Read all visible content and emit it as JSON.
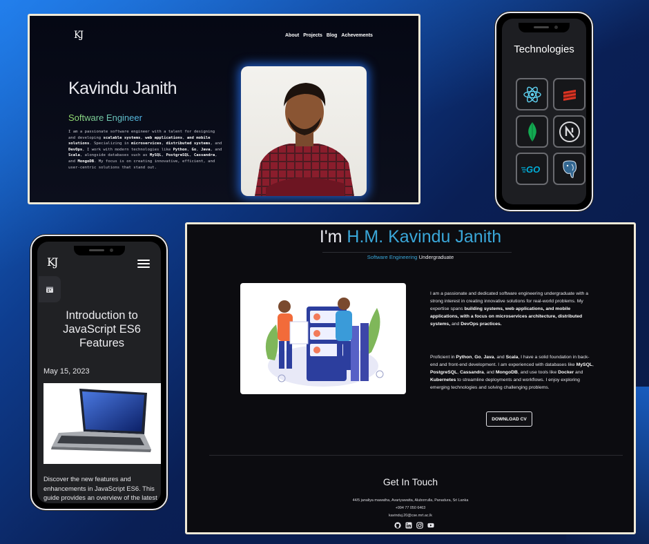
{
  "hero": {
    "logo": "KJ",
    "nav": [
      "About",
      "Projects",
      "Blog",
      "Achevements"
    ],
    "name": "Kavindu Janith",
    "role": "Software Engineer",
    "bio_parts": [
      "I am a passionate software engineer with a talent for designing and developing ",
      "scalable systems",
      ", ",
      "web applications",
      ", ",
      "and mobile solutions",
      ". Specializing in ",
      "microservices",
      ", ",
      "distributed systems",
      ", and ",
      "DevOps",
      ", I work with modern technologies like ",
      "Python",
      ", ",
      "Go",
      ", ",
      "Java",
      ", and ",
      "Scala",
      ", alongside databases such as ",
      "MySQL",
      ", ",
      "PostgreSQL",
      ", ",
      "Cassandra",
      ", and ",
      "MongoDB",
      ". My focus is on creating innovative, efficient, and user-centric solutions that stand out."
    ]
  },
  "tech": {
    "title": "Technologies",
    "icons": [
      "react-icon",
      "scala-icon",
      "mongodb-icon",
      "nextjs-icon",
      "go-icon",
      "postgresql-icon"
    ],
    "go_label": "GO"
  },
  "blog": {
    "logo": "KJ",
    "title": "Introduction to JavaScript ES6 Features",
    "date": "May 15, 2023",
    "description": "Discover the new features and enhancements in JavaScript ES6. This guide provides an overview of the latest"
  },
  "about": {
    "heading_prefix": "I'm ",
    "heading_name": "H.M. Kavindu Janith",
    "sub_highlight": "Software Engineering",
    "sub_rest": " Undergraduate",
    "p1_parts": [
      "I am a passionate and dedicated software engineering undergraduate with a strong interest in creating innovative solutions for real-world problems. My expertise spans ",
      "building systems, web applications, and mobile applications, with a focus on microservices architecture, distributed systems,",
      " and ",
      "DevOps practices."
    ],
    "p2_parts": [
      "Proficient in ",
      "Python",
      ", ",
      "Go",
      ", ",
      "Java",
      ", and ",
      "Scala",
      ", I have a solid foundation in back-end and front-end development. I am experienced with databases like ",
      "MySQL",
      ", ",
      "PostgreSQL",
      ", ",
      "Cassandra",
      ", and ",
      "MongoDB",
      ", and use tools like ",
      "Docker",
      " and ",
      "Kubernetes",
      " to streamline deployments and workflows. I enjoy exploring emerging technologies and solving challenging problems."
    ],
    "cv_button": "DOWNLOAD CV",
    "get_in_touch": "Get In Touch",
    "address": "44/5 janaliya mawatha, Avariyawatta, Aluborrulla, Panadura, Sri Lanka",
    "phone": "+994 77 050 6463",
    "email": "kavinduj.20@cse.mrt.ac.lk",
    "socials": [
      "github-icon",
      "linkedin-icon",
      "instagram-icon",
      "youtube-icon"
    ]
  },
  "colors": {
    "accent": "#3aa7d9",
    "border": "#f1ead8",
    "glow": "#2878ff"
  }
}
